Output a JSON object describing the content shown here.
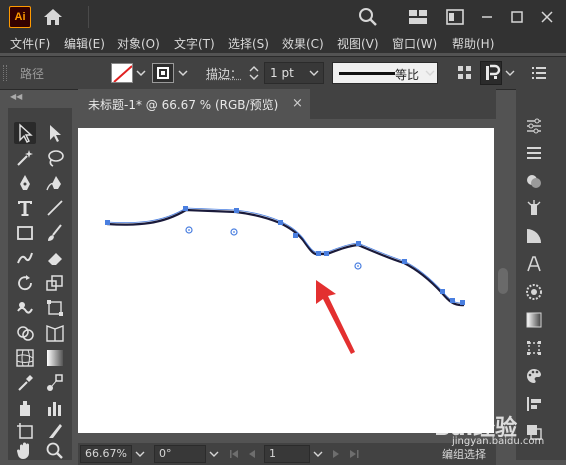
{
  "app": {
    "logo_text": "Ai"
  },
  "menu": {
    "items": [
      "文件(F)",
      "编辑(E)",
      "对象(O)",
      "文字(T)",
      "选择(S)",
      "效果(C)",
      "视图(V)",
      "窗口(W)",
      "帮助(H)"
    ]
  },
  "control_bar": {
    "selection_label": "路径",
    "stroke_label": "描边：",
    "stroke_weight": "1 pt",
    "profile_label": "等比",
    "colors": {
      "fill": "#ffffff",
      "no_fill_slash": "#e02020",
      "stroke": "#2e2e2e"
    }
  },
  "document": {
    "tab_title": "未标题-1* @ 66.67 % (RGB/预览)",
    "close_glyph": "×"
  },
  "status_bar": {
    "zoom": "66.67%",
    "rotation": "0°",
    "artboard_number": "1",
    "status_text": "编组选择"
  },
  "watermark": {
    "logo": "Bai经验",
    "url": "jingyan.baidu.com"
  },
  "colors": {
    "accent_anchor": "#4a7fe0",
    "path": "#1a1a3a",
    "arrow": "#e33030",
    "ui_dark": "#323232",
    "ui_mid": "#424242",
    "ui_bg": "#535353"
  },
  "icons": {
    "titlebar": [
      "home-icon",
      "search-icon",
      "arrange-documents-icon",
      "panel-icon",
      "minimize-icon",
      "maximize-icon",
      "close-icon"
    ],
    "tools": [
      "selection-tool-icon",
      "direct-selection-tool-icon",
      "magic-wand-icon",
      "lasso-icon",
      "pen-tool-icon",
      "curvature-tool-icon",
      "type-tool-icon",
      "line-tool-icon",
      "rectangle-tool-icon",
      "paintbrush-icon",
      "shaper-tool-icon",
      "eraser-icon",
      "rotate-tool-icon",
      "scale-tool-icon",
      "warp-tool-icon",
      "free-transform-icon",
      "shape-builder-icon",
      "perspective-grid-icon",
      "mesh-tool-icon",
      "gradient-tool-icon",
      "eyedropper-icon",
      "blend-tool-icon",
      "symbol-sprayer-icon",
      "column-graph-icon",
      "artboard-tool-icon",
      "slice-tool-icon",
      "hand-tool-icon",
      "zoom-tool-icon"
    ]
  }
}
